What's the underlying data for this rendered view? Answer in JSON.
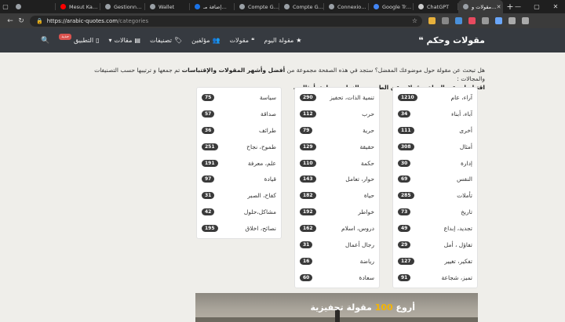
{
  "browser": {
    "tabs": [
      {
        "label": "",
        "color": "#9aa0a6",
        "active": false
      },
      {
        "label": "Mesut Ka…",
        "color": "#ff0000",
        "active": false
      },
      {
        "label": "Gestionn…",
        "color": "#9aa0a6",
        "active": false
      },
      {
        "label": "Wallet",
        "color": "#9aa0a6",
        "active": false
      },
      {
        "label": "إضافة مـ…",
        "color": "#1a73e8",
        "active": false
      },
      {
        "label": "Compte G…",
        "color": "#9aa0a6",
        "active": false
      },
      {
        "label": "Compte G…",
        "color": "#9aa0a6",
        "active": false
      },
      {
        "label": "Connexio…",
        "color": "#9aa0a6",
        "active": false
      },
      {
        "label": "Google Tr…",
        "color": "#4285f4",
        "active": false
      },
      {
        "label": "ChatGPT",
        "color": "#cccccc",
        "active": false
      },
      {
        "label": "مقولات و…",
        "color": "#9aa0a6",
        "active": true
      }
    ],
    "url_host": "https://arabic-quotes.com",
    "url_path": "/categories"
  },
  "nav": {
    "brand": "مقولات وحكم",
    "items": [
      {
        "label": "مقولة اليوم",
        "icon": "star-icon",
        "glyph": "★"
      },
      {
        "label": "مقولات",
        "icon": "quote-icon",
        "glyph": "❝"
      },
      {
        "label": "مؤلفين",
        "icon": "users-icon",
        "glyph": "👥"
      },
      {
        "label": "تصنيفات",
        "icon": "tag-icon",
        "glyph": "🏷"
      },
      {
        "label": "مقالات",
        "icon": "newspaper-icon",
        "glyph": "▤"
      },
      {
        "label": "التطبيق",
        "icon": "mobile-icon",
        "glyph": "▯"
      }
    ],
    "badge": "جديد"
  },
  "intro": {
    "q": "هل تبحث عن مقولة حول موضوعك المفضل؟ ستجد في هذه الصفحة مجموعة من",
    "bold1": "أفضل وأشهر المقولات والإقتباسات",
    "rest": "تم جمعها و ترتيبها حسب التصنيفات والمجالات :",
    "bold2": "اقتباسات عن الحياة، مقولات عن الطموح و النجاح، سعادة، أمثال..."
  },
  "categories": {
    "col1": [
      {
        "name": "آراء، عام",
        "count": "1210"
      },
      {
        "name": "آباء، أبناء",
        "count": "34"
      },
      {
        "name": "أخرى",
        "count": "111"
      },
      {
        "name": "أمثال",
        "count": "308"
      },
      {
        "name": "إدارة",
        "count": "30"
      },
      {
        "name": "النفس",
        "count": "69"
      },
      {
        "name": "تأملات",
        "count": "285"
      },
      {
        "name": "تاريخ",
        "count": "73"
      },
      {
        "name": "تجديد، إبداع",
        "count": "49"
      },
      {
        "name": "تفاؤل ، أمل",
        "count": "29"
      },
      {
        "name": "تفكير، تغيير",
        "count": "127"
      },
      {
        "name": "تميز، شجاعة",
        "count": "91"
      }
    ],
    "col2": [
      {
        "name": "تنمية الذات، تحفيز",
        "count": "290"
      },
      {
        "name": "حرب",
        "count": "112"
      },
      {
        "name": "حرية",
        "count": "79"
      },
      {
        "name": "حقيقة",
        "count": "129"
      },
      {
        "name": "حكمة",
        "count": "110"
      },
      {
        "name": "حوار، تعامل",
        "count": "143"
      },
      {
        "name": "حياة",
        "count": "182"
      },
      {
        "name": "خواطر",
        "count": "192"
      },
      {
        "name": "دروس، اسلام",
        "count": "162"
      },
      {
        "name": "رجال أعمال",
        "count": "31"
      },
      {
        "name": "رياضة",
        "count": "16"
      },
      {
        "name": "سعادة",
        "count": "60"
      }
    ],
    "col3": [
      {
        "name": "سياسة",
        "count": "75"
      },
      {
        "name": "صداقة",
        "count": "57"
      },
      {
        "name": "طرائف",
        "count": "36"
      },
      {
        "name": "طموح، نجاح",
        "count": "251"
      },
      {
        "name": "علم، معرفة",
        "count": "191"
      },
      {
        "name": "قيادة",
        "count": "97"
      },
      {
        "name": "كفاح، الصبر",
        "count": "31"
      },
      {
        "name": "مشاكل،حلول",
        "count": "42"
      },
      {
        "name": "نصائح، اخلاق",
        "count": "195"
      }
    ]
  },
  "banner": {
    "pre": "أروع",
    "number": "100",
    "post": "مقولة تحفيزية"
  }
}
